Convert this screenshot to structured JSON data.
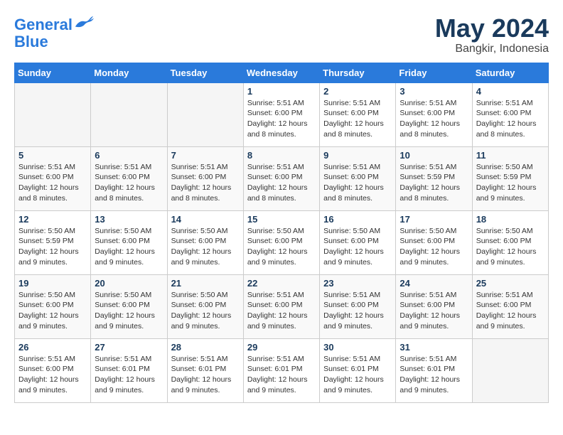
{
  "logo": {
    "line1": "General",
    "line2": "Blue"
  },
  "title": "May 2024",
  "location": "Bangkir, Indonesia",
  "weekdays": [
    "Sunday",
    "Monday",
    "Tuesday",
    "Wednesday",
    "Thursday",
    "Friday",
    "Saturday"
  ],
  "weeks": [
    [
      {
        "day": "",
        "sunrise": "",
        "sunset": "",
        "daylight": ""
      },
      {
        "day": "",
        "sunrise": "",
        "sunset": "",
        "daylight": ""
      },
      {
        "day": "",
        "sunrise": "",
        "sunset": "",
        "daylight": ""
      },
      {
        "day": "1",
        "sunrise": "Sunrise: 5:51 AM",
        "sunset": "Sunset: 6:00 PM",
        "daylight": "Daylight: 12 hours and 8 minutes."
      },
      {
        "day": "2",
        "sunrise": "Sunrise: 5:51 AM",
        "sunset": "Sunset: 6:00 PM",
        "daylight": "Daylight: 12 hours and 8 minutes."
      },
      {
        "day": "3",
        "sunrise": "Sunrise: 5:51 AM",
        "sunset": "Sunset: 6:00 PM",
        "daylight": "Daylight: 12 hours and 8 minutes."
      },
      {
        "day": "4",
        "sunrise": "Sunrise: 5:51 AM",
        "sunset": "Sunset: 6:00 PM",
        "daylight": "Daylight: 12 hours and 8 minutes."
      }
    ],
    [
      {
        "day": "5",
        "sunrise": "Sunrise: 5:51 AM",
        "sunset": "Sunset: 6:00 PM",
        "daylight": "Daylight: 12 hours and 8 minutes."
      },
      {
        "day": "6",
        "sunrise": "Sunrise: 5:51 AM",
        "sunset": "Sunset: 6:00 PM",
        "daylight": "Daylight: 12 hours and 8 minutes."
      },
      {
        "day": "7",
        "sunrise": "Sunrise: 5:51 AM",
        "sunset": "Sunset: 6:00 PM",
        "daylight": "Daylight: 12 hours and 8 minutes."
      },
      {
        "day": "8",
        "sunrise": "Sunrise: 5:51 AM",
        "sunset": "Sunset: 6:00 PM",
        "daylight": "Daylight: 12 hours and 8 minutes."
      },
      {
        "day": "9",
        "sunrise": "Sunrise: 5:51 AM",
        "sunset": "Sunset: 6:00 PM",
        "daylight": "Daylight: 12 hours and 8 minutes."
      },
      {
        "day": "10",
        "sunrise": "Sunrise: 5:51 AM",
        "sunset": "Sunset: 5:59 PM",
        "daylight": "Daylight: 12 hours and 8 minutes."
      },
      {
        "day": "11",
        "sunrise": "Sunrise: 5:50 AM",
        "sunset": "Sunset: 5:59 PM",
        "daylight": "Daylight: 12 hours and 9 minutes."
      }
    ],
    [
      {
        "day": "12",
        "sunrise": "Sunrise: 5:50 AM",
        "sunset": "Sunset: 5:59 PM",
        "daylight": "Daylight: 12 hours and 9 minutes."
      },
      {
        "day": "13",
        "sunrise": "Sunrise: 5:50 AM",
        "sunset": "Sunset: 6:00 PM",
        "daylight": "Daylight: 12 hours and 9 minutes."
      },
      {
        "day": "14",
        "sunrise": "Sunrise: 5:50 AM",
        "sunset": "Sunset: 6:00 PM",
        "daylight": "Daylight: 12 hours and 9 minutes."
      },
      {
        "day": "15",
        "sunrise": "Sunrise: 5:50 AM",
        "sunset": "Sunset: 6:00 PM",
        "daylight": "Daylight: 12 hours and 9 minutes."
      },
      {
        "day": "16",
        "sunrise": "Sunrise: 5:50 AM",
        "sunset": "Sunset: 6:00 PM",
        "daylight": "Daylight: 12 hours and 9 minutes."
      },
      {
        "day": "17",
        "sunrise": "Sunrise: 5:50 AM",
        "sunset": "Sunset: 6:00 PM",
        "daylight": "Daylight: 12 hours and 9 minutes."
      },
      {
        "day": "18",
        "sunrise": "Sunrise: 5:50 AM",
        "sunset": "Sunset: 6:00 PM",
        "daylight": "Daylight: 12 hours and 9 minutes."
      }
    ],
    [
      {
        "day": "19",
        "sunrise": "Sunrise: 5:50 AM",
        "sunset": "Sunset: 6:00 PM",
        "daylight": "Daylight: 12 hours and 9 minutes."
      },
      {
        "day": "20",
        "sunrise": "Sunrise: 5:50 AM",
        "sunset": "Sunset: 6:00 PM",
        "daylight": "Daylight: 12 hours and 9 minutes."
      },
      {
        "day": "21",
        "sunrise": "Sunrise: 5:50 AM",
        "sunset": "Sunset: 6:00 PM",
        "daylight": "Daylight: 12 hours and 9 minutes."
      },
      {
        "day": "22",
        "sunrise": "Sunrise: 5:51 AM",
        "sunset": "Sunset: 6:00 PM",
        "daylight": "Daylight: 12 hours and 9 minutes."
      },
      {
        "day": "23",
        "sunrise": "Sunrise: 5:51 AM",
        "sunset": "Sunset: 6:00 PM",
        "daylight": "Daylight: 12 hours and 9 minutes."
      },
      {
        "day": "24",
        "sunrise": "Sunrise: 5:51 AM",
        "sunset": "Sunset: 6:00 PM",
        "daylight": "Daylight: 12 hours and 9 minutes."
      },
      {
        "day": "25",
        "sunrise": "Sunrise: 5:51 AM",
        "sunset": "Sunset: 6:00 PM",
        "daylight": "Daylight: 12 hours and 9 minutes."
      }
    ],
    [
      {
        "day": "26",
        "sunrise": "Sunrise: 5:51 AM",
        "sunset": "Sunset: 6:00 PM",
        "daylight": "Daylight: 12 hours and 9 minutes."
      },
      {
        "day": "27",
        "sunrise": "Sunrise: 5:51 AM",
        "sunset": "Sunset: 6:01 PM",
        "daylight": "Daylight: 12 hours and 9 minutes."
      },
      {
        "day": "28",
        "sunrise": "Sunrise: 5:51 AM",
        "sunset": "Sunset: 6:01 PM",
        "daylight": "Daylight: 12 hours and 9 minutes."
      },
      {
        "day": "29",
        "sunrise": "Sunrise: 5:51 AM",
        "sunset": "Sunset: 6:01 PM",
        "daylight": "Daylight: 12 hours and 9 minutes."
      },
      {
        "day": "30",
        "sunrise": "Sunrise: 5:51 AM",
        "sunset": "Sunset: 6:01 PM",
        "daylight": "Daylight: 12 hours and 9 minutes."
      },
      {
        "day": "31",
        "sunrise": "Sunrise: 5:51 AM",
        "sunset": "Sunset: 6:01 PM",
        "daylight": "Daylight: 12 hours and 9 minutes."
      },
      {
        "day": "",
        "sunrise": "",
        "sunset": "",
        "daylight": ""
      }
    ]
  ]
}
